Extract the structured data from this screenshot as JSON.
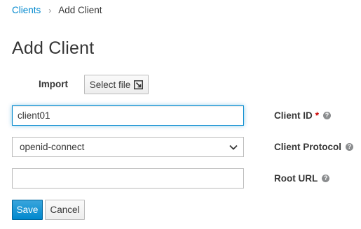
{
  "breadcrumb": {
    "parent": "Clients",
    "separator": "›",
    "current": "Add Client"
  },
  "page_title": "Add Client",
  "import": {
    "label": "Import",
    "button_label": "Select file"
  },
  "form": {
    "client_id": {
      "label": "Client ID",
      "required_marker": "*",
      "value": "client01",
      "help": "?"
    },
    "client_protocol": {
      "label": "Client Protocol",
      "selected": "openid-connect",
      "help": "?"
    },
    "root_url": {
      "label": "Root URL",
      "value": "",
      "help": "?"
    }
  },
  "actions": {
    "save_label": "Save",
    "cancel_label": "Cancel"
  },
  "colors": {
    "link": "#0088ce",
    "primary": "#0088ce",
    "required": "#cc0000",
    "text": "#363636"
  }
}
